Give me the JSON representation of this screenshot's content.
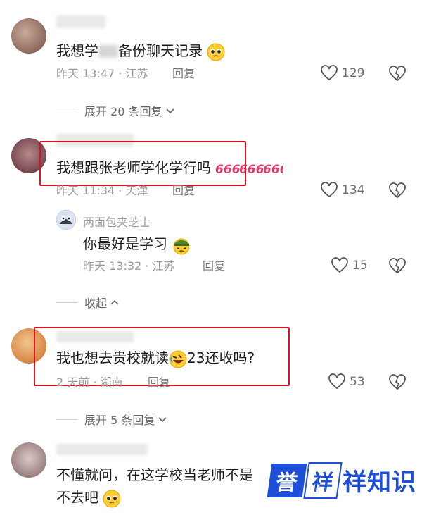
{
  "comments": [
    {
      "text_part1": "我想学",
      "text_part2": "备份聊天记录",
      "time": "昨天 13:47 · 江苏",
      "reply_label": "回复",
      "likes": "129",
      "expand_label": "展开 20 条回复"
    },
    {
      "text": "我想跟张老师学化学行吗",
      "time": "昨天 11:34 · 天津",
      "reply_label": "回复",
      "likes": "134",
      "sub_reply": {
        "username": "两面包夹芝士",
        "text": "你最好是学习",
        "time": "昨天 13:32 · 江苏",
        "reply_label": "回复",
        "likes": "15"
      },
      "collapse_label": "收起"
    },
    {
      "text_part1": "我也想去贵校就读",
      "text_part2": "23还收吗?",
      "time": "2 天前 · 湖南",
      "reply_label": "回复",
      "likes": "53",
      "expand_label": "展开 5 条回复"
    },
    {
      "text_line1": "不懂就问，在这学校当老师不是",
      "text_line2": "不去吧"
    }
  ],
  "watermark": {
    "char1": "誉",
    "char2": "祥",
    "rest": "祥知识"
  },
  "colors": {
    "highlight_box": "#d8121e",
    "watermark": "#1d4fd8"
  }
}
